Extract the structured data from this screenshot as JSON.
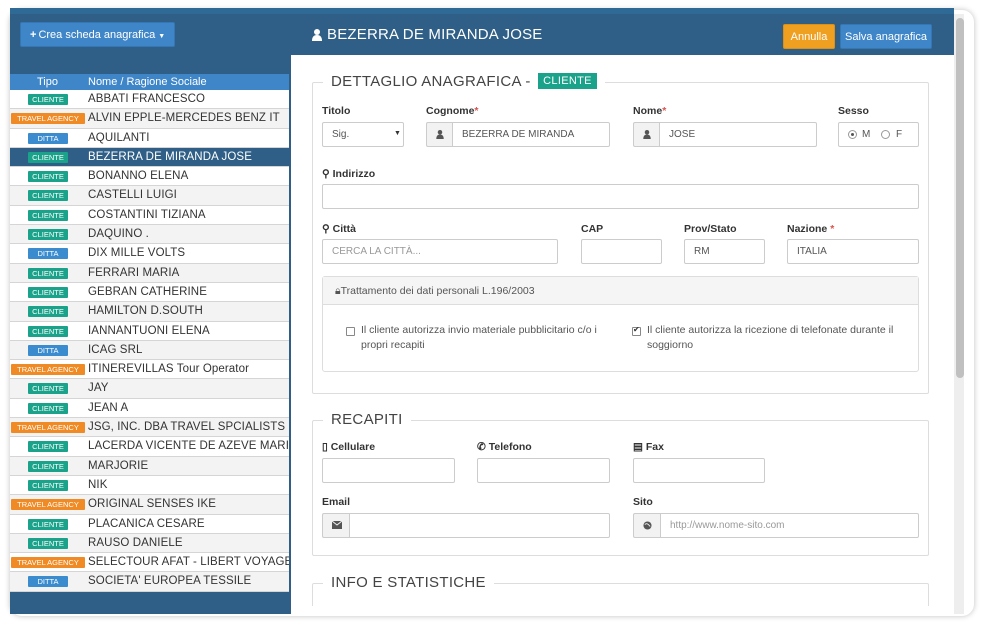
{
  "sidebar": {
    "new_button_label": "Crea scheda anagrafica",
    "header": {
      "tipo": "Tipo",
      "nome": "Nome / Ragione Sociale"
    },
    "rows": [
      {
        "type": "CLIENTE",
        "name": "ABBATI FRANCESCO"
      },
      {
        "type": "TRAVEL AGENCY",
        "name": "ALVIN EPPLE-MERCEDES BENZ IT"
      },
      {
        "type": "DITTA",
        "name": "AQUILANTI"
      },
      {
        "type": "CLIENTE",
        "name": "BEZERRA DE MIRANDA JOSE",
        "selected": true
      },
      {
        "type": "CLIENTE",
        "name": "BONANNO ELENA"
      },
      {
        "type": "CLIENTE",
        "name": "CASTELLI LUIGI"
      },
      {
        "type": "CLIENTE",
        "name": "COSTANTINI TIZIANA"
      },
      {
        "type": "CLIENTE",
        "name": "DAQUINO ."
      },
      {
        "type": "DITTA",
        "name": "DIX MILLE VOLTS"
      },
      {
        "type": "CLIENTE",
        "name": "FERRARI MARIA"
      },
      {
        "type": "CLIENTE",
        "name": "GEBRAN CATHERINE"
      },
      {
        "type": "CLIENTE",
        "name": "HAMILTON D.SOUTH"
      },
      {
        "type": "CLIENTE",
        "name": "IANNANTUONI ELENA"
      },
      {
        "type": "DITTA",
        "name": "ICAG SRL"
      },
      {
        "type": "TRAVEL AGENCY",
        "name": "ITINEREVILLAS Tour Operator"
      },
      {
        "type": "CLIENTE",
        "name": "JAY"
      },
      {
        "type": "CLIENTE",
        "name": "JEAN A"
      },
      {
        "type": "TRAVEL AGENCY",
        "name": "JSG, INC. DBA TRAVEL SPCIALISTS"
      },
      {
        "type": "CLIENTE",
        "name": "LACERDA VICENTE DE AZEVE MARIA"
      },
      {
        "type": "CLIENTE",
        "name": "MARJORIE"
      },
      {
        "type": "CLIENTE",
        "name": "NIK"
      },
      {
        "type": "TRAVEL AGENCY",
        "name": "ORIGINAL SENSES IKE"
      },
      {
        "type": "CLIENTE",
        "name": "PLACANICA CESARE"
      },
      {
        "type": "CLIENTE",
        "name": "RAUSO DANIELE"
      },
      {
        "type": "TRAVEL AGENCY",
        "name": "SELECTOUR AFAT - LIBERT VOYAGES"
      },
      {
        "type": "DITTA",
        "name": "SOCIETA' EUROPEA TESSILE"
      }
    ]
  },
  "header": {
    "title": "BEZERRA DE MIRANDA JOSE",
    "cancel_label": "Annulla",
    "save_label": "Salva anagrafica"
  },
  "detail": {
    "legend": "DETTAGLIO ANAGRAFICA -",
    "type_tag": "CLIENTE",
    "titolo": {
      "label": "Titolo",
      "value": "Sig."
    },
    "cognome": {
      "label": "Cognome",
      "required": "*",
      "value": "BEZERRA DE MIRANDA"
    },
    "nome": {
      "label": "Nome",
      "required": "*",
      "value": "JOSE"
    },
    "sesso": {
      "label": "Sesso",
      "options": [
        "M",
        "F"
      ],
      "selected": "M"
    },
    "indirizzo": {
      "label": "Indirizzo",
      "value": ""
    },
    "citta": {
      "label": "Città",
      "placeholder": "CERCA LA CITTÀ..."
    },
    "cap": {
      "label": "CAP",
      "value": ""
    },
    "prov": {
      "label": "Prov/Stato",
      "value": "RM"
    },
    "nazione": {
      "label": "Nazione",
      "required": "*",
      "value": "ITALIA"
    },
    "privacy": {
      "title": "Trattamento dei dati personali L.196/2003",
      "consent1": {
        "text": "Il cliente autorizza invio materiale pubblicitario c/o i propri recapiti",
        "checked": false
      },
      "consent2": {
        "text": "Il cliente autorizza la ricezione di telefonate durante il soggiorno",
        "checked": true
      }
    }
  },
  "recapiti": {
    "legend": "RECAPITI",
    "cellulare": "Cellulare",
    "telefono": "Telefono",
    "fax": "Fax",
    "email": "Email",
    "sito": {
      "label": "Sito",
      "placeholder": "http://www.nome-sito.com"
    }
  },
  "info": {
    "legend": "INFO E STATISTICHE"
  },
  "colors": {
    "cliente": "#1aa38a",
    "ditta": "#3a8ccf",
    "travel_agency": "#f08a24",
    "header": "#2f5f86",
    "accent": "#3f86c9",
    "cancel": "#f0a020"
  }
}
